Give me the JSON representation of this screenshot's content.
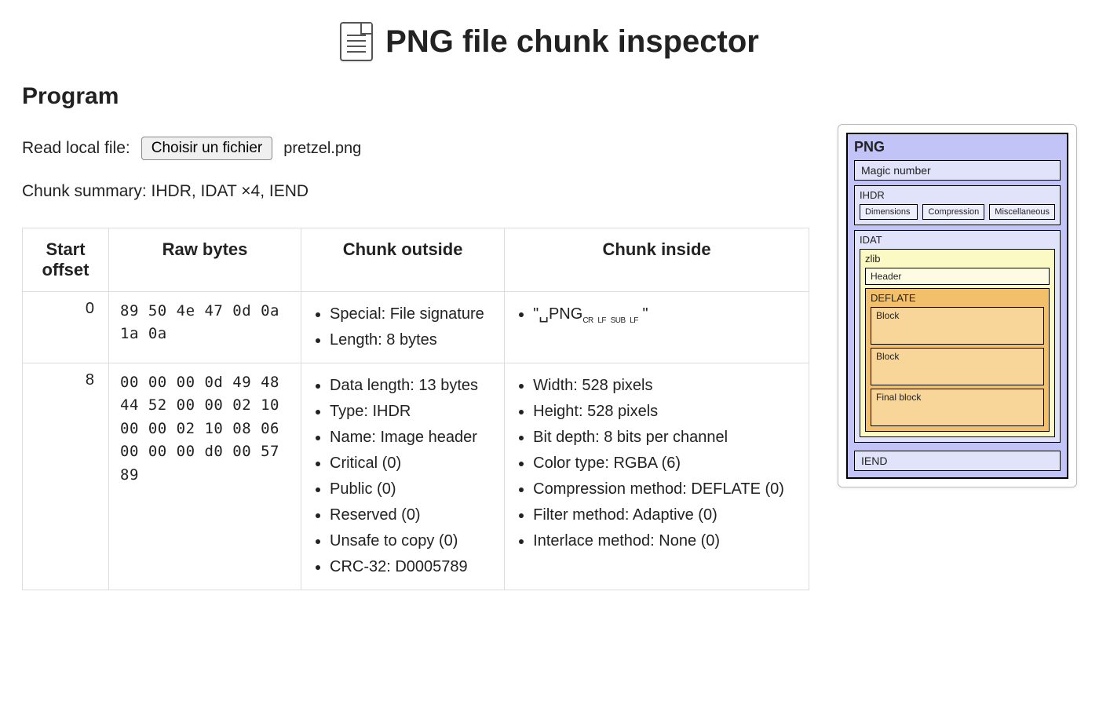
{
  "page_title": "PNG file chunk inspector",
  "section_heading": "Program",
  "file_row": {
    "label": "Read local file:",
    "button": "Choisir un fichier",
    "filename": "pretzel.png"
  },
  "summary": "Chunk summary: IHDR, IDAT ×4, IEND",
  "table": {
    "headers": [
      "Start offset",
      "Raw bytes",
      "Chunk outside",
      "Chunk inside"
    ],
    "rows": [
      {
        "offset": "0",
        "raw": "89 50 4e 47 0d 0a 1a 0a",
        "outside": [
          "Special: File signature",
          "Length: 8 bytes"
        ],
        "inside_raw": "\"␣PNG"
      },
      {
        "offset": "8",
        "raw": "00 00 00 0d 49 48 44 52 00 00 02 10 00 00 02 10 08 06 00 00 00 d0 00 57 89",
        "outside": [
          "Data length: 13 bytes",
          "Type: IHDR",
          "Name: Image header",
          "Critical (0)",
          "Public (0)",
          "Reserved (0)",
          "Unsafe to copy (0)",
          "CRC-32: D0005789"
        ],
        "inside": [
          "Width: 528 pixels",
          "Height: 528 pixels",
          "Bit depth: 8 bits per channel",
          "Color type: RGBA (6)",
          "Compression method: DEFLATE (0)",
          "Filter method: Adaptive (0)",
          "Interlace method: None (0)"
        ]
      }
    ]
  },
  "diagram": {
    "title": "PNG",
    "magic": "Magic number",
    "ihdr": {
      "label": "IHDR",
      "cells": [
        "Dimensions",
        "Compression",
        "Miscellaneous"
      ]
    },
    "idat": {
      "label": "IDAT",
      "zlib": {
        "label": "zlib",
        "header": "Header",
        "deflate": {
          "label": "DEFLATE",
          "blocks": [
            "Block",
            "Block",
            "Final block"
          ]
        }
      }
    },
    "iend": "IEND"
  }
}
